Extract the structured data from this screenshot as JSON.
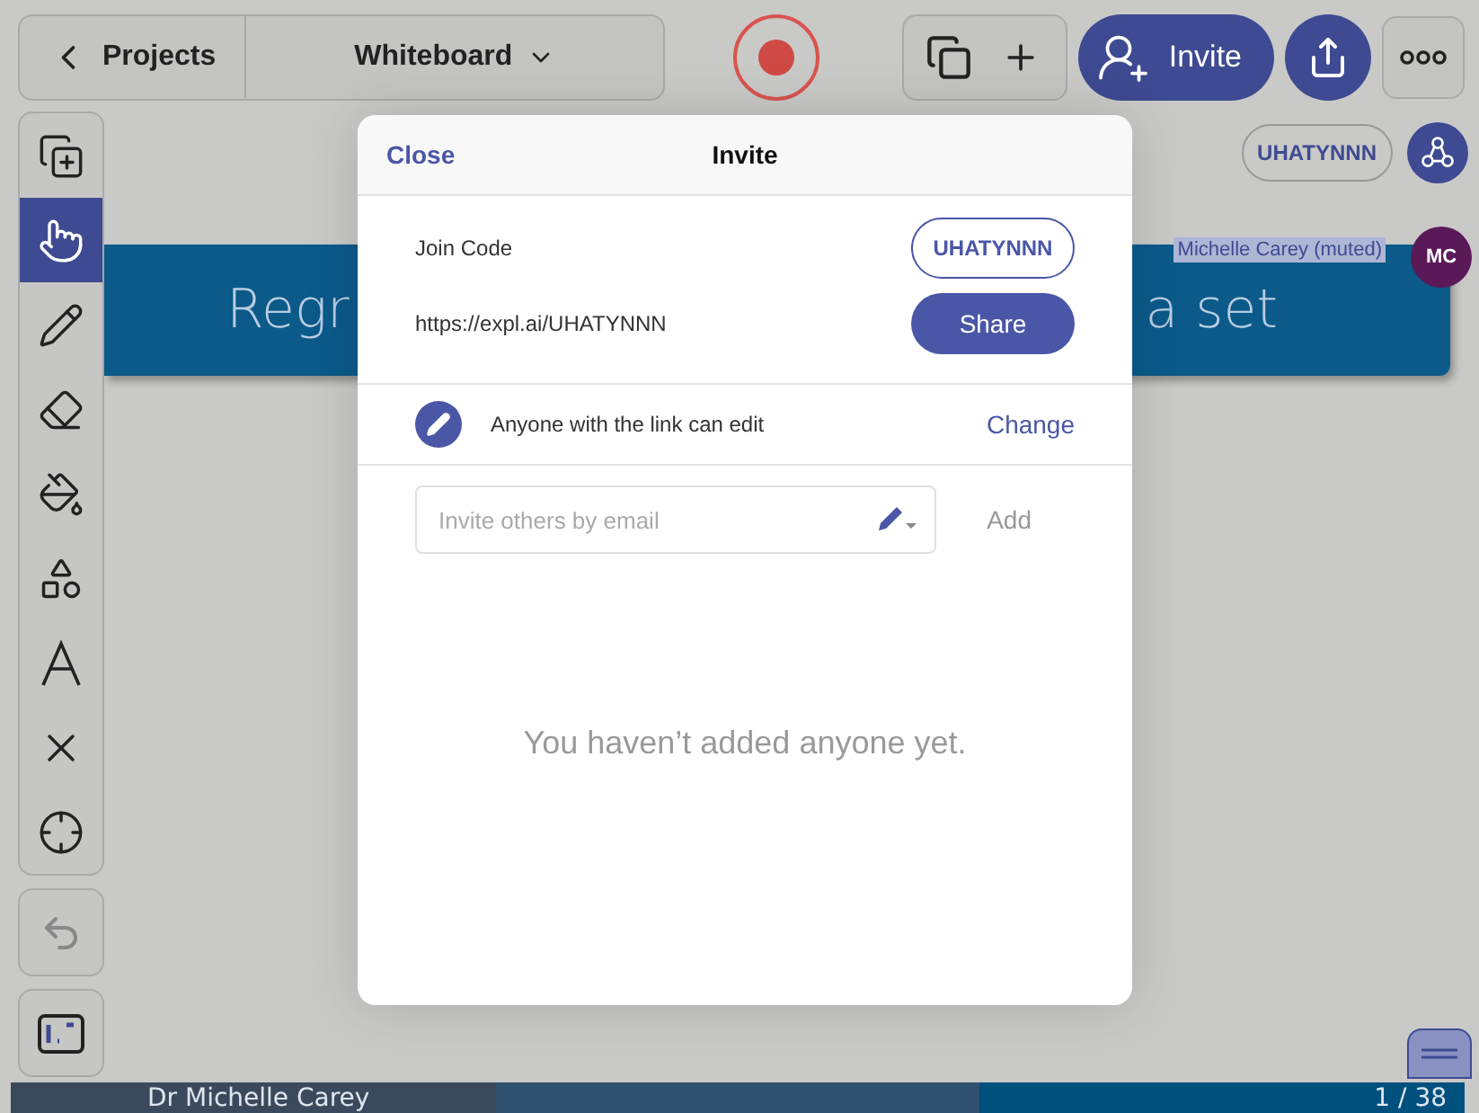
{
  "toolbar": {
    "back": "Projects",
    "board": "Whiteboard",
    "invite": "Invite"
  },
  "tools": [
    {
      "kind": "duplicate",
      "selected": false
    },
    {
      "kind": "hand",
      "selected": true
    },
    {
      "kind": "pencil",
      "selected": false
    },
    {
      "kind": "eraser",
      "selected": false
    },
    {
      "kind": "fill",
      "selected": false
    },
    {
      "kind": "shapes",
      "selected": false
    },
    {
      "kind": "text",
      "selected": false
    },
    {
      "kind": "delete",
      "selected": false
    },
    {
      "kind": "target",
      "selected": false
    }
  ],
  "session": {
    "code": "UHATYNNN",
    "participant": "Michelle Carey (muted)",
    "initials": "MC",
    "color": "#5a1a58"
  },
  "slide": {
    "title_left": "Regr",
    "title_right": "a set"
  },
  "modal": {
    "close": "Close",
    "title": "Invite",
    "join_code_label": "Join Code",
    "join_code": "UHATYNNN",
    "link": "https://expl.ai/UHATYNNN",
    "share": "Share",
    "permission": "Anyone with the link can edit",
    "change": "Change",
    "email_placeholder": "Invite others by email",
    "add": {
      "label": "Add",
      "disabled": true
    },
    "empty": "You haven’t added anyone yet."
  },
  "status_bar": {
    "presenter": "Dr Michelle Carey",
    "page": "1 / 38"
  }
}
